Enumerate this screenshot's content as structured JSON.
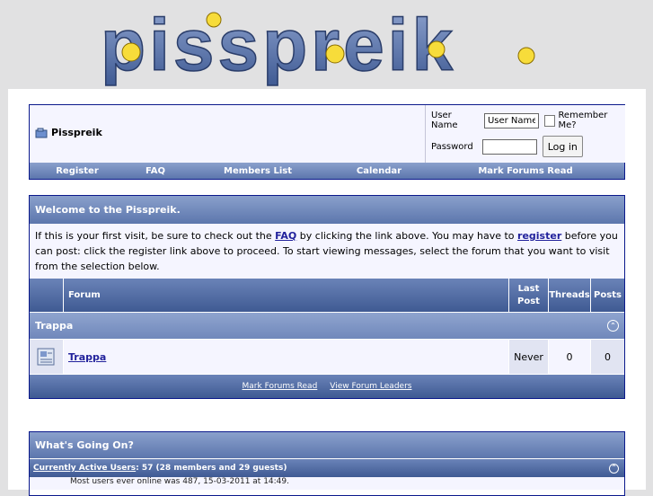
{
  "logo": {
    "text": "pisspreik"
  },
  "breadcrumb": {
    "title": "Pisspreik"
  },
  "login": {
    "username_label": "User Name",
    "username_value": "User Name",
    "remember_label": "Remember Me?",
    "password_label": "Password",
    "login_button": "Log in"
  },
  "navbar": {
    "items": [
      "Register",
      "FAQ",
      "Members List",
      "Calendar",
      "Mark Forums Read"
    ]
  },
  "welcome": {
    "title": "Welcome to the Pisspreik.",
    "text_1": "If this is your first visit, be sure to check out the ",
    "faq_link": "FAQ",
    "text_2": " by clicking the link above. You may have to ",
    "register_link": "register",
    "text_3": " before you can post: click the register link above to proceed. To start viewing messages, select the forum that you want to visit from the selection below."
  },
  "table": {
    "headers": {
      "forum": "Forum",
      "last_post": "Last Post",
      "threads": "Threads",
      "posts": "Posts"
    },
    "category": "Trappa",
    "rows": [
      {
        "forum": "Trappa",
        "last_post": "Never",
        "threads": "0",
        "posts": "0"
      }
    ],
    "footer_links": [
      "Mark Forums Read",
      "View Forum Leaders"
    ]
  },
  "whats_going_on": {
    "title": "What's Going On?",
    "active_users_link": "Currently Active Users",
    "active_users_text": ": 57 (28 members and 29 guests)",
    "most_users": "Most users ever online was 487, 15-03-2011 at 14:49."
  },
  "colors": {
    "accent": "#5c76ad",
    "border": "#0b198c",
    "link": "#22229c"
  }
}
